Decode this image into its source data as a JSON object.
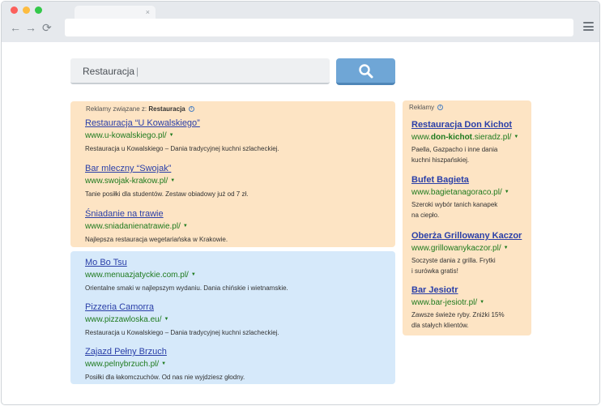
{
  "search": {
    "query": "Restauracja"
  },
  "top_ads": {
    "label_prefix": "Reklamy związane z:",
    "label_keyword": "Restauracja",
    "items": [
      {
        "title": "Restauracja “U Kowalskiego”",
        "url": "www.u-kowalskiego.pl/",
        "desc": "Restauracja u Kowalskiego – Dania tradycyjnej kuchni szlacheckiej."
      },
      {
        "title": "Bar mleczny “Swojak”",
        "url": "www.swojak-krakow.pl/",
        "desc": "Tanie posiłki dla studentów. Zestaw obiadowy już od 7 zł."
      },
      {
        "title": "Śniadanie na trawie",
        "url": "www.sniadanienatrawie.pl/",
        "desc": "Najlepsza restauracja wegetariańska w Krakowie."
      }
    ]
  },
  "organic": {
    "items": [
      {
        "title": "Mo Bo Tsu",
        "url": "www.menuazjatyckie.com.pl/",
        "desc": "Orientalne smaki w najlepszym wydaniu. Dania chińskie i wietnamskie."
      },
      {
        "title": "Pizzeria Camorra",
        "url": "www.pizzawloska.eu/",
        "desc": "Restauracja u Kowalskiego – Dania tradycyjnej kuchni szlacheckiej."
      },
      {
        "title": "Zajazd Pełny Brzuch",
        "url": "www.pelnybrzuch.pl/",
        "desc": "Posiłki dla łakomczuchów. Od nas nie wyjdziesz głodny."
      }
    ]
  },
  "side_ads": {
    "label": "Reklamy",
    "items": [
      {
        "title": "Restauracja Don Kichot",
        "url_prefix": "www.",
        "url_bold": "don-kichot",
        "url_suffix": ".sieradz.pl/",
        "desc_lines": [
          "Paella, Gazpacho i inne dania",
          "kuchni hiszpańskiej."
        ]
      },
      {
        "title": "Bufet Bagieta",
        "url": "www.bagietanagoraco.pl/",
        "desc_lines": [
          "Szeroki wybór tanich kanapek",
          "na ciepło."
        ]
      },
      {
        "title": "Oberża Grillowany Kaczor",
        "url": "www.grillowanykaczor.pl/",
        "desc_lines": [
          "Soczyste dania z grilla. Frytki",
          "i surówka gratis!"
        ]
      },
      {
        "title": "Bar Jesiotr",
        "url": "www.bar-jesiotr.pl/",
        "desc_lines": [
          "Zawsze świeże ryby. Zniżki 15%",
          "dla stałych klientów."
        ]
      }
    ]
  },
  "icons": {
    "tab_close": "×",
    "back": "←",
    "forward": "→",
    "reload": "⟳",
    "info": "i",
    "dropdown": "▼"
  },
  "colors": {
    "ad_panel": "#fde4c4",
    "organic_panel": "#d6e9fa",
    "search_button": "#6fa6d6",
    "link": "#2a3fa8",
    "url": "#1e7a1e"
  }
}
